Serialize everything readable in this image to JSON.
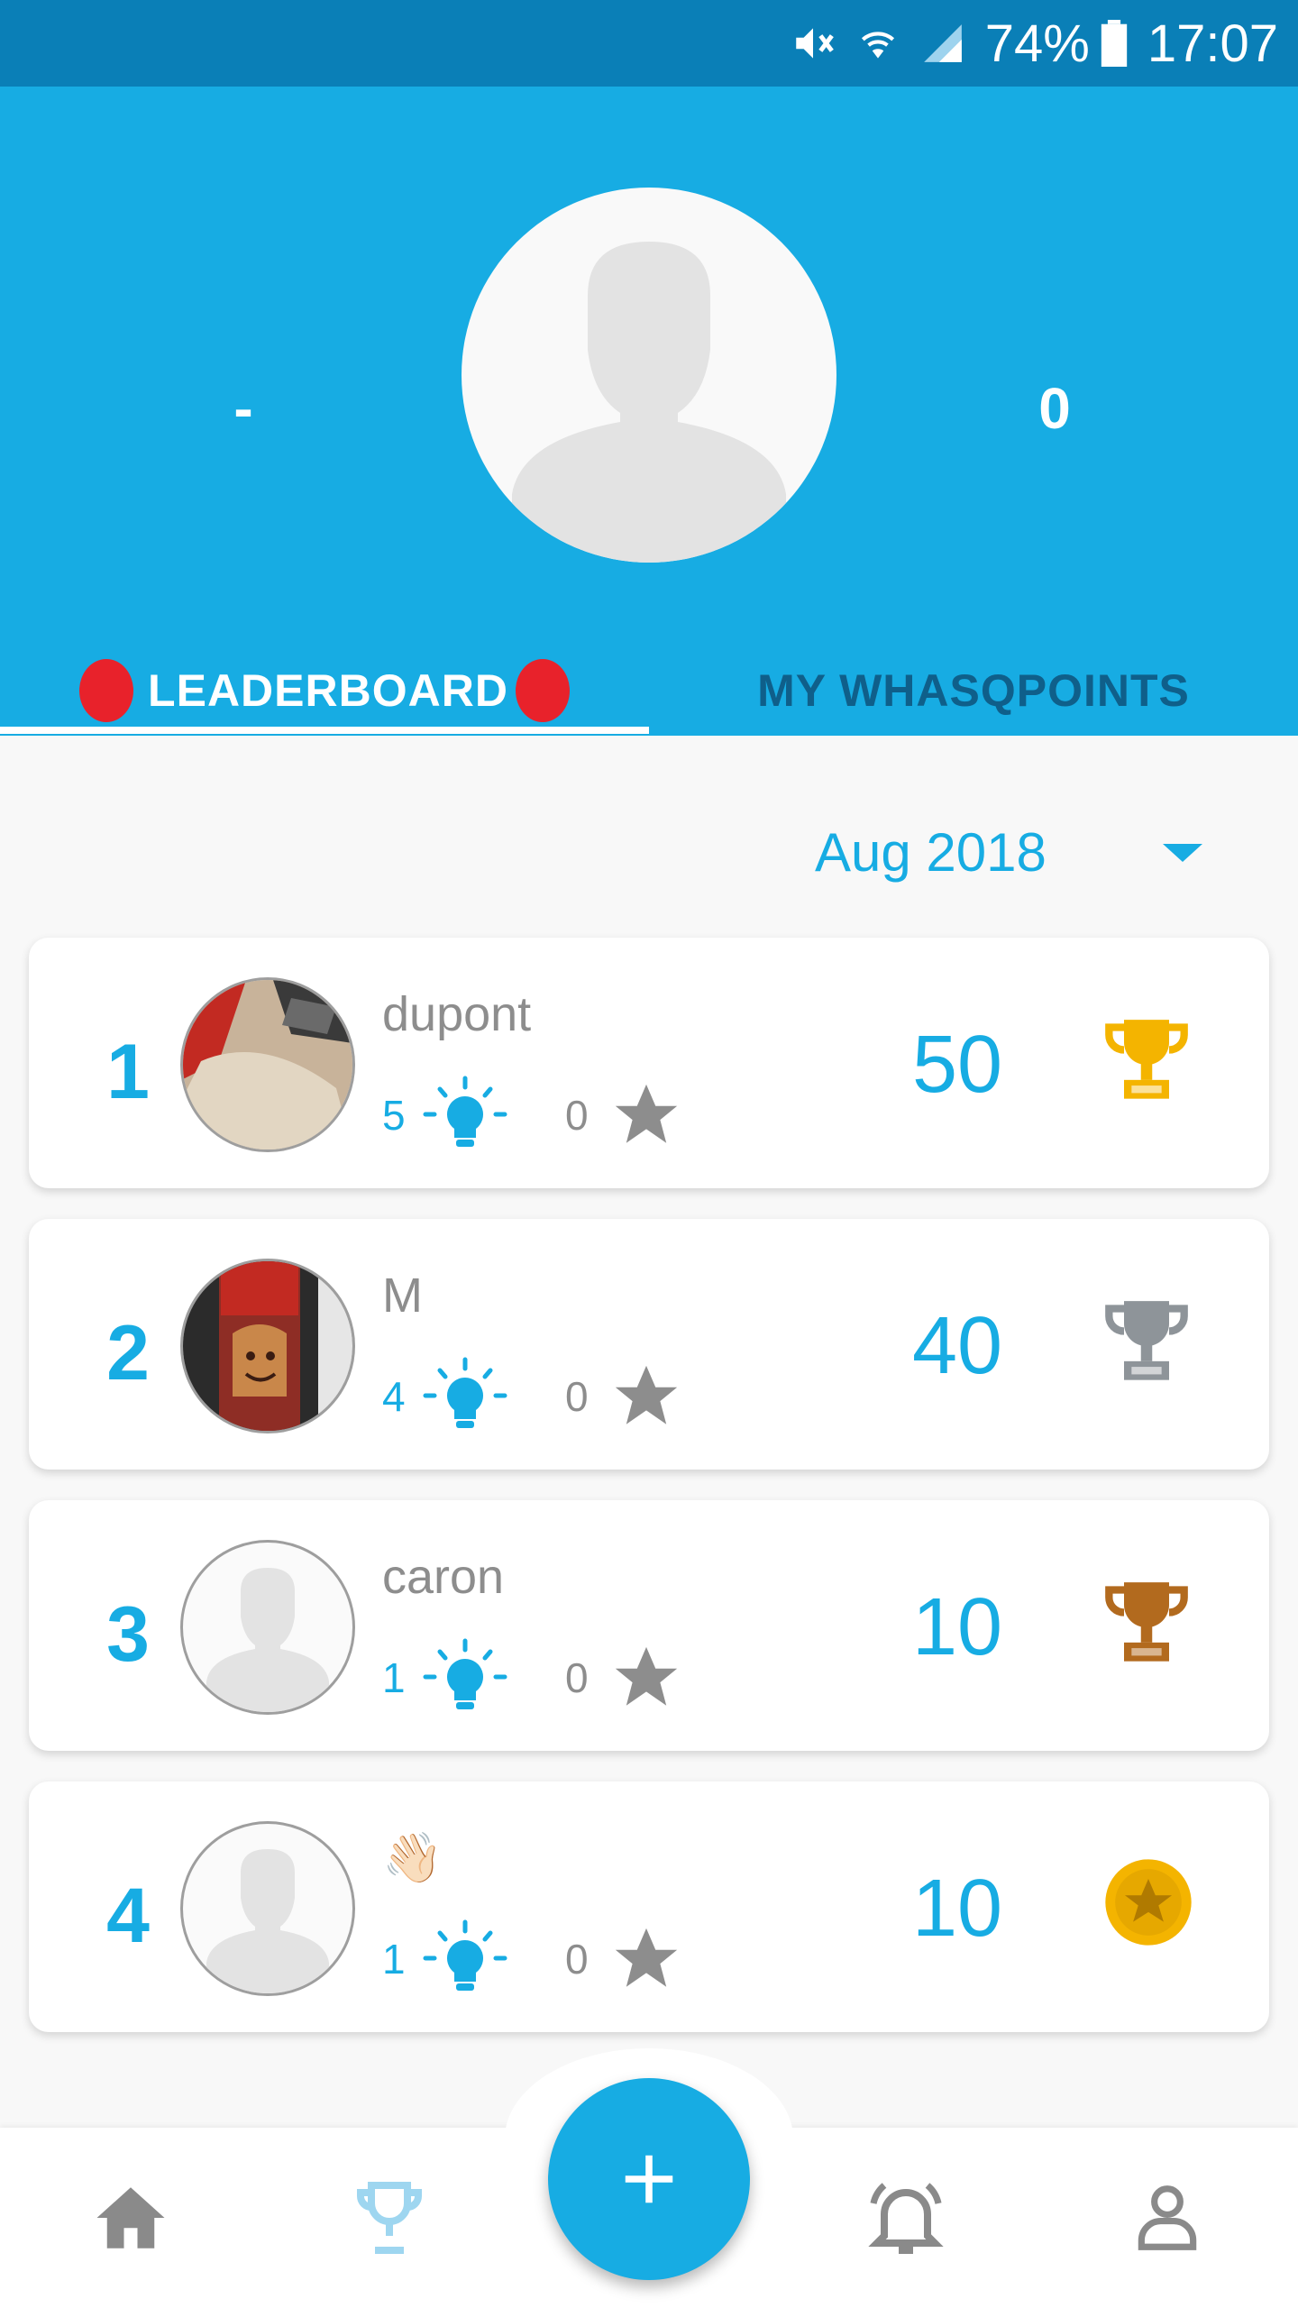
{
  "status_bar": {
    "battery_percent": "74%",
    "time": "17:07",
    "icons": [
      "mute-icon",
      "wifi-icon",
      "signal-icon",
      "battery-icon"
    ]
  },
  "header": {
    "left_stat": "-",
    "right_stat": "0",
    "avatar_icon": "person-placeholder-icon"
  },
  "tabs": [
    {
      "label": "LEADERBOARD",
      "active": true
    },
    {
      "label": "MY WHASQPOINTS",
      "active": false
    }
  ],
  "month_selector": {
    "label": "Aug 2018",
    "icon": "caret-down-icon"
  },
  "leaderboard": [
    {
      "rank": "1",
      "name": "dupont",
      "ideas": "5",
      "stars": "0",
      "score": "50",
      "award": "gold-trophy-icon"
    },
    {
      "rank": "2",
      "name": "M",
      "ideas": "4",
      "stars": "0",
      "score": "40",
      "award": "silver-trophy-icon"
    },
    {
      "rank": "3",
      "name": "caron",
      "ideas": "1",
      "stars": "0",
      "score": "10",
      "award": "bronze-trophy-icon"
    },
    {
      "rank": "4",
      "name": "👋🏻",
      "ideas": "1",
      "stars": "0",
      "score": "10",
      "award": "star-medal-icon"
    }
  ],
  "colors": {
    "primary": "#17ACE3",
    "status_bar": "#0A7FB7",
    "gold": "#F4B400",
    "silver": "#8E9499",
    "bronze": "#B26A1E",
    "badge_red": "#E8222B"
  },
  "bottom_nav": [
    "home-icon",
    "trophy-icon",
    "add-icon",
    "bell-icon",
    "profile-icon"
  ]
}
